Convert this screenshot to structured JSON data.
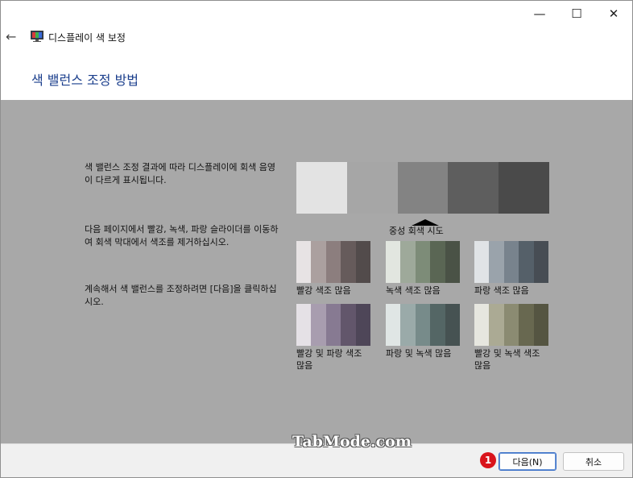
{
  "window": {
    "controls": {
      "minimize": "—",
      "maximize": "☐",
      "close": "✕"
    }
  },
  "nav": {
    "back_icon": "←",
    "app_title": "디스플레이 색 보정"
  },
  "heading": "색 밸런스 조정 방법",
  "instructions": [
    "색 밸런스 조정 결과에 따라 디스플레이에 회색 음영이 다르게 표시됩니다.",
    "다음 페이지에서 빨강, 녹색, 파랑 슬라이더를 이동하여 회색 막대에서 색조를 제거하십시오.",
    "계속해서 색 밸런스를 조정하려면 [다음]을 클릭하십시오."
  ],
  "neutral_bar": {
    "label": "중성 회색 시도",
    "colors": [
      "#e3e3e3",
      "#a6a6a6",
      "#838383",
      "#5e5e5e",
      "#4a4a4a"
    ]
  },
  "swatches": [
    {
      "label": "빨강 색조 많음",
      "colors": [
        "#e7e3e4",
        "#aba09f",
        "#8c7e7e",
        "#665b5b",
        "#524b4b"
      ]
    },
    {
      "label": "녹색 색조 많음",
      "colors": [
        "#e2e6e0",
        "#9ea99a",
        "#7d8c78",
        "#5a6654",
        "#4a5246"
      ]
    },
    {
      "label": "파랑 색조 많음",
      "colors": [
        "#e0e3e6",
        "#9aa3ab",
        "#78838d",
        "#556069",
        "#474d54"
      ]
    },
    {
      "label": "빨강 및 파랑 색조 많음",
      "colors": [
        "#e5e1e6",
        "#a89daf",
        "#877a92",
        "#62566b",
        "#4e4658"
      ]
    },
    {
      "label": "파랑 및 녹색 많음",
      "colors": [
        "#e0e6e5",
        "#9aaaa9",
        "#778b8a",
        "#546665",
        "#465252"
      ]
    },
    {
      "label": "빨강 및 녹색 색조 많음",
      "colors": [
        "#e6e6df",
        "#abaa94",
        "#8b8b72",
        "#686850",
        "#555542"
      ]
    }
  ],
  "footer": {
    "next_button": "다음(N)",
    "cancel_button": "취소",
    "step_marker": "1",
    "watermark": "TabMode.com"
  }
}
